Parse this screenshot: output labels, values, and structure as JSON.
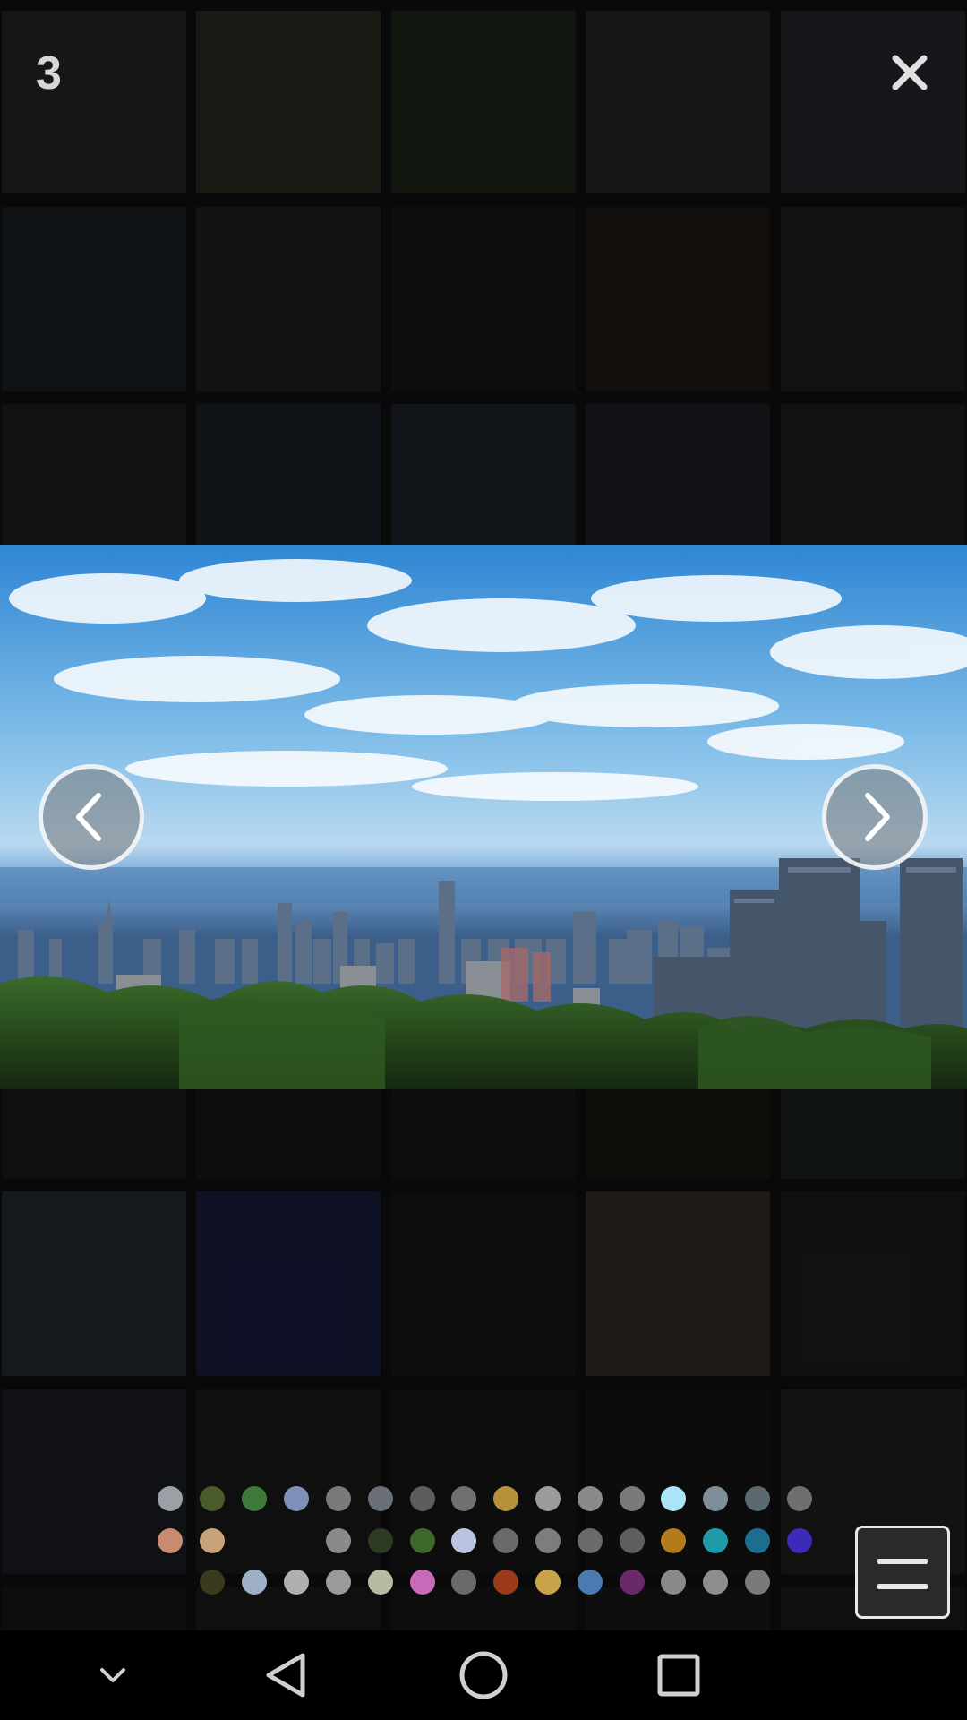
{
  "viewer": {
    "counter": "3"
  },
  "icons": {
    "close": "close-icon",
    "previous": "chevron-left-icon",
    "next": "chevron-right-icon",
    "menu": "menu-icon",
    "nav_down": "chevron-down-icon",
    "nav_back": "back-triangle-icon",
    "nav_home": "home-circle-icon",
    "nav_recents": "recents-square-icon"
  },
  "colors": {
    "swatches_row1": [
      "#9aa0a6",
      "#4a5a2a",
      "#3f7a3a",
      "#7f8fb8",
      "#7a7a7a",
      "#6b6f78",
      "#5c5c5c",
      "#707070",
      "#b7903a",
      "#9c9c9c",
      "#8a8a8a",
      "#7a7a7a",
      "#a9e4f7",
      "#7f8f99",
      "#5a6a70",
      "#6f6f6f"
    ],
    "swatches_row2": [
      "#c98b6f",
      "#c9a27a",
      "#8a8a8a",
      "#2e3a22",
      "#3d6a2a",
      "#b9c4e0",
      "#6a6a6a",
      "#7d7d7d",
      "#6a6a6a",
      "#5e5e5e",
      "#b57a1a",
      "#1f9aa8",
      "#1c6d8f",
      "#3b2bb8"
    ],
    "swatches_row3": [
      "#3a3a1c",
      "#9fb0c8",
      "#b0b0b0",
      "#9a9a9a",
      "#b9bba0",
      "#c86ab8",
      "#6a6a6a",
      "#9a3a1a",
      "#caa24a",
      "#4a7ab0",
      "#6a2a6a",
      "#8a8a8a",
      "#8e8e8e",
      "#7a7a7a"
    ]
  }
}
